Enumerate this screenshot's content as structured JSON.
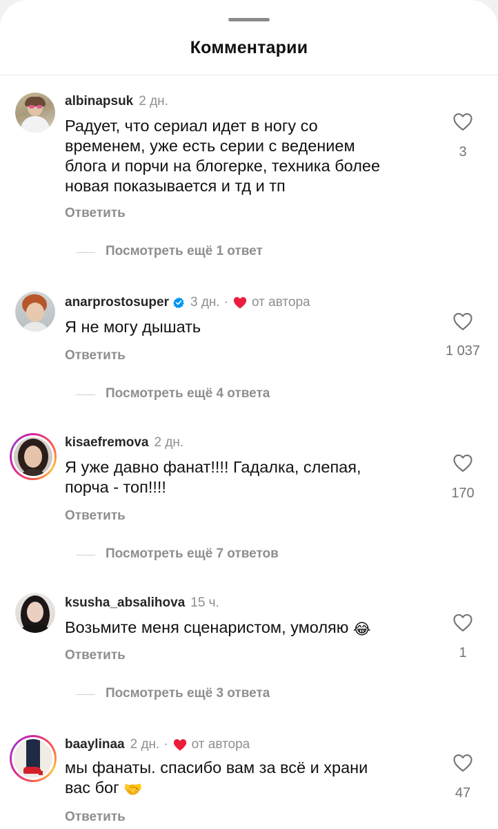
{
  "header": {
    "title": "Комментарии"
  },
  "comments": [
    {
      "username": "albinapsuk",
      "time": "2 дн.",
      "text_lines": [
        "Радует, что сериал идет в ногу со",
        "временем, уже есть серии с ведением",
        "блога и порчи на блогерке, техника более",
        "новая показывается и тд и тп"
      ],
      "reply_label": "Ответить",
      "likes": "3",
      "more_replies": "Посмотреть ещё 1 ответ"
    },
    {
      "username": "anarprostosuper",
      "verified": true,
      "time": "3 дн.",
      "separator": "·",
      "by_author": "от автора",
      "text_lines": [
        "Я не могу дышать"
      ],
      "reply_label": "Ответить",
      "likes": "1 037",
      "more_replies": "Посмотреть ещё 4 ответа"
    },
    {
      "username": "kisaefremova",
      "time": "2 дн.",
      "text_lines": [
        "Я уже давно фанат!!!! Гадалка, слепая,",
        "порча - топ!!!!"
      ],
      "reply_label": "Ответить",
      "likes": "170",
      "more_replies": "Посмотреть ещё 7 ответов"
    },
    {
      "username": "ksusha_absalihova",
      "time": "15 ч.",
      "text_lines": [
        "Возьмите меня сценаристом, умоляю"
      ],
      "emoji": "😂",
      "reply_label": "Ответить",
      "likes": "1",
      "more_replies": "Посмотреть ещё 3 ответа"
    },
    {
      "username": "baaylinaa",
      "time": "2 дн.",
      "separator": "·",
      "by_author": "от автора",
      "text_lines": [
        "мы фанаты. спасибо вам за всё и храни",
        "вас бог"
      ],
      "emoji": "🤝",
      "reply_label": "Ответить",
      "likes": "47"
    }
  ],
  "icons": {
    "like": "heart-outline-icon",
    "author_like": "heart-filled-icon",
    "verified": "verified-badge-icon"
  },
  "colors": {
    "accent_red": "#ed1c3a",
    "verified_blue": "#0095f6",
    "secondary_text": "#8e8e8e"
  }
}
